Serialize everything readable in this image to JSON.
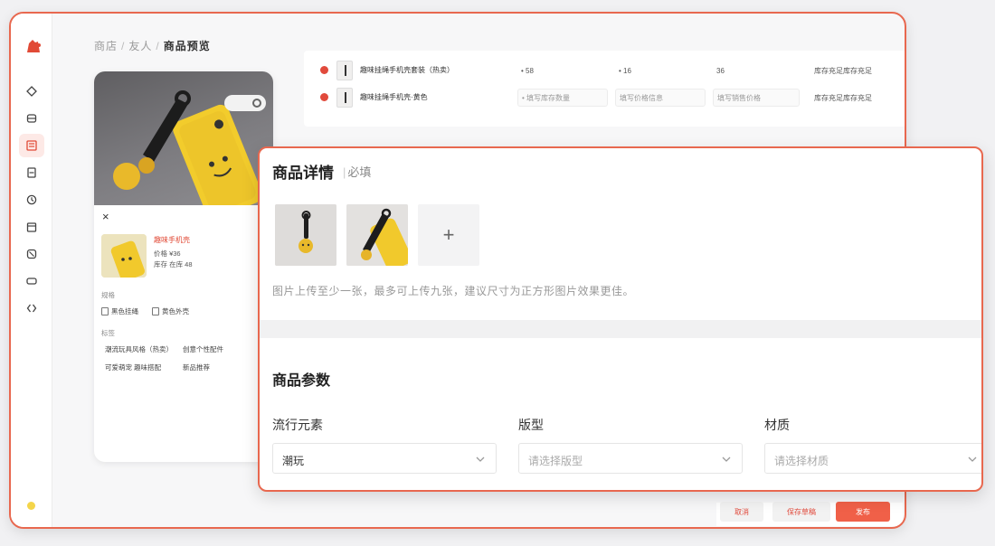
{
  "breadcrumb": {
    "crumb1": "商店",
    "crumb2": "友人",
    "current": "商品预览",
    "sep": "/"
  },
  "sidebar": {
    "items": [
      {
        "name": "diamond"
      },
      {
        "name": "box"
      },
      {
        "name": "goods"
      },
      {
        "name": "doc"
      },
      {
        "name": "clock"
      },
      {
        "name": "calendar"
      },
      {
        "name": "block"
      },
      {
        "name": "ticket"
      },
      {
        "name": "code"
      }
    ]
  },
  "preview": {
    "close": "×",
    "sku_name": "趣味手机壳",
    "line1": "价格  ¥36",
    "line2": "库存  在库 48",
    "spec_label": "规格",
    "spec1": "黑色挂绳",
    "spec2": "黄色外壳",
    "tag_label": "标签",
    "tag1": "潮流玩具风格（热卖）",
    "tag2": "创意个性配件",
    "tag3": "可爱萌宠   趣味搭配",
    "tag4": "新品推荐"
  },
  "sku_list": {
    "rows": [
      {
        "name": "趣味挂绳手机壳套装（热卖）",
        "c1": "• 58",
        "c2": "• 16",
        "c3": "36",
        "c4": "库存充足库存充足"
      },
      {
        "name": "趣味挂绳手机壳·黄色",
        "c1": "• 填写库存数量",
        "c2": "填写价格信息",
        "c3": "填写销售价格",
        "c4": "库存充足库存充足"
      }
    ]
  },
  "footer": {
    "ghost1": "取消",
    "ghost2": "保存草稿",
    "primary": "发布"
  },
  "dialog": {
    "title": "商品详情",
    "subtitle": "必填",
    "add": "+",
    "note": "图片上传至少一张，最多可上传九张，建议尺寸为正方形图片效果更佳。",
    "params_title": "商品参数",
    "params": [
      {
        "label": "流行元素",
        "value": "潮玩",
        "placeholder": false
      },
      {
        "label": "版型",
        "value": "请选择版型",
        "placeholder": true
      },
      {
        "label": "材质",
        "value": "请选择材质",
        "placeholder": true
      }
    ]
  },
  "colors": {
    "accent": "#e8684f",
    "primary_button": "#f06048",
    "danger_dot": "#e14a3c"
  }
}
